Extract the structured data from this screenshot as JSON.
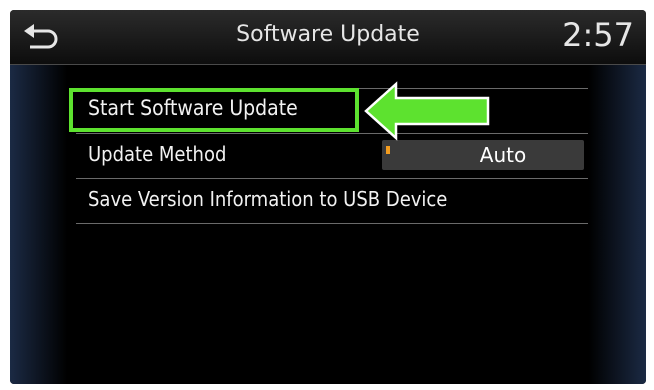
{
  "header": {
    "title": "Software Update",
    "clock": "2:57",
    "back_icon": "back-arrow-icon"
  },
  "menu": {
    "items": [
      {
        "label": "Start Software Update"
      },
      {
        "label": "Update Method",
        "value": "Auto"
      },
      {
        "label": "Save Version Information to USB Device"
      }
    ]
  },
  "annotation": {
    "highlight_color": "#5de22f",
    "value_indicator_color": "#f29c1f"
  }
}
